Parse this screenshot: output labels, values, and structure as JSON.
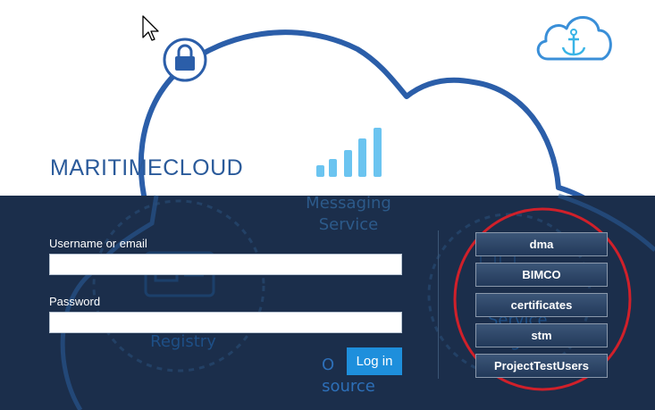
{
  "brand": {
    "title": "MARITIMECLOUD"
  },
  "background_labels": {
    "messaging_line1": "Messaging",
    "messaging_line2": "Service",
    "registry": "Registry",
    "open_source_line1": "O",
    "open_source_line2": "source",
    "service_registry_line1": "Service",
    "service_registry_line2": "Regist"
  },
  "login_form": {
    "username_label": "Username or email",
    "username_value": "",
    "password_label": "Password",
    "password_value": "",
    "login_button": "Log in"
  },
  "identity_providers": [
    {
      "label": "dma"
    },
    {
      "label": "BIMCO"
    },
    {
      "label": "certificates"
    },
    {
      "label": "stm"
    },
    {
      "label": "ProjectTestUsers"
    }
  ],
  "colors": {
    "dark_panel": "#1b2e4b",
    "cloud_outline": "#2b5ea9",
    "signal_bars": "#6bc4f0",
    "login_button": "#1e8fdc",
    "highlight_circle": "#d0202a"
  },
  "icons": [
    "lock-icon",
    "signal-icon",
    "cloud-anchor-logo-icon",
    "cursor-icon",
    "registry-card-icon"
  ]
}
